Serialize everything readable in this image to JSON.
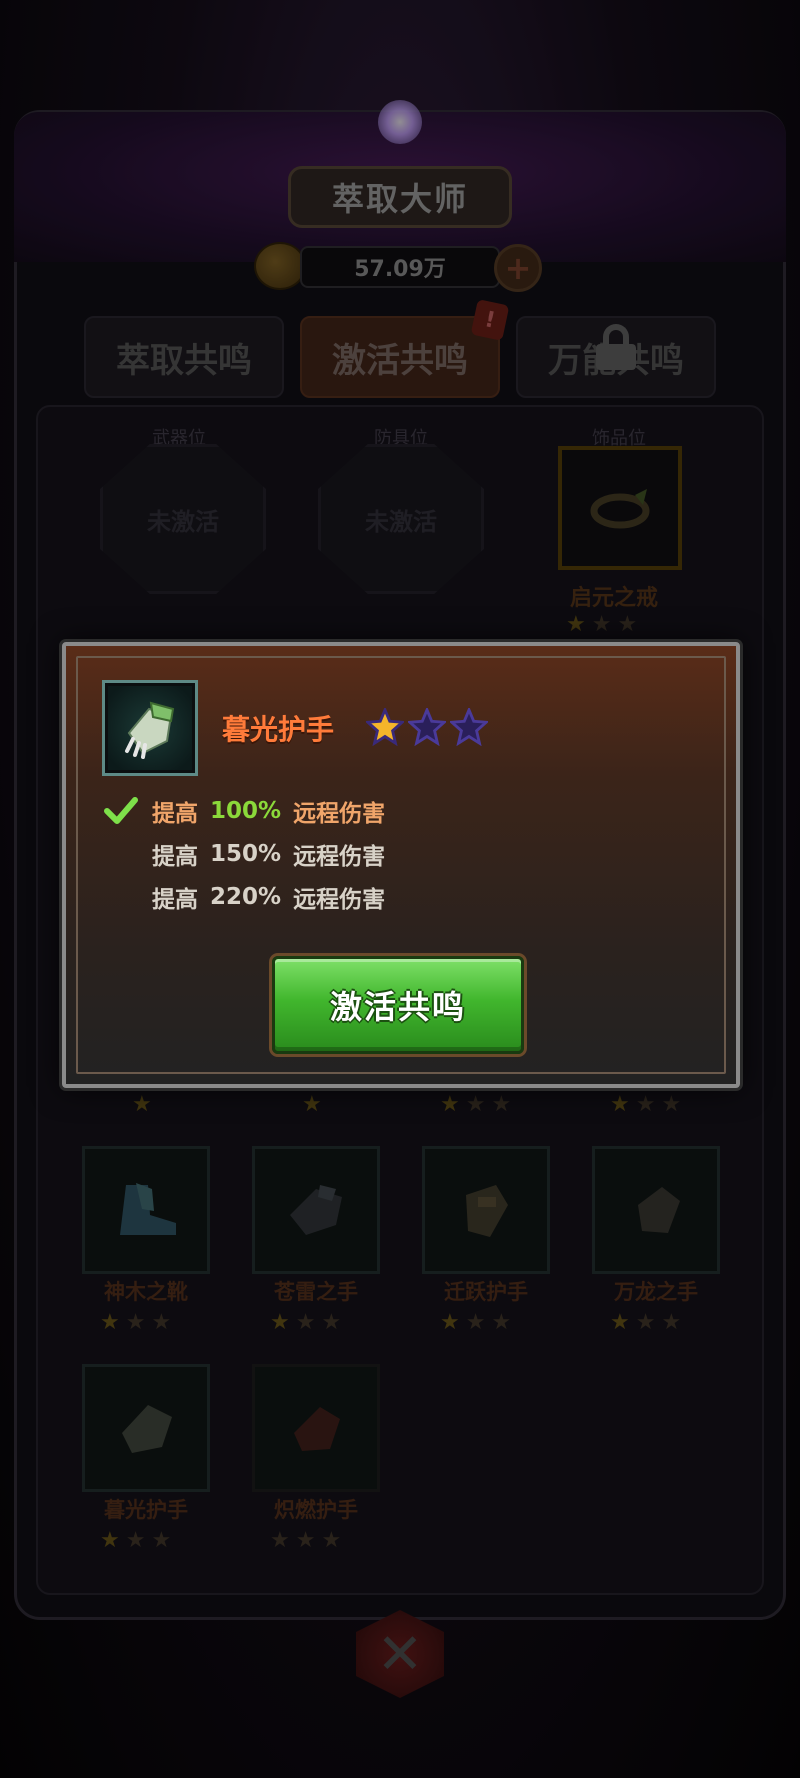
{
  "header": {
    "title": "萃取大师",
    "currency_amount": "57.09万",
    "plus_label": "+"
  },
  "tabs": [
    {
      "label": "萃取共鸣"
    },
    {
      "label": "激活共鸣"
    },
    {
      "label": "万能共鸣",
      "locked": true
    }
  ],
  "badge": "!",
  "slots": [
    {
      "label": "武器位",
      "state": "未激活"
    },
    {
      "label": "防具位",
      "state": "未激活"
    },
    {
      "label": "饰品位",
      "name": "启元之戒",
      "stars": 1
    }
  ],
  "items_row1_stars": [
    1,
    1,
    1,
    1
  ],
  "items": [
    {
      "name": "神木之靴",
      "stars": 1
    },
    {
      "name": "苍雷之手",
      "stars": 1
    },
    {
      "name": "迁跃护手",
      "stars": 1
    },
    {
      "name": "万龙之手",
      "stars": 1
    },
    {
      "name": "暮光护手",
      "stars": 1
    },
    {
      "name": "炽燃护手",
      "stars": 0
    }
  ],
  "popup": {
    "item_name": "暮光护手",
    "stars_filled": 1,
    "stars_total": 3,
    "effects": [
      {
        "label": "提高",
        "value": "100%",
        "what": "远程伤害",
        "active": true
      },
      {
        "label": "提高",
        "value": "150%",
        "what": "远程伤害",
        "active": false
      },
      {
        "label": "提高",
        "value": "220%",
        "what": "远程伤害",
        "active": false
      }
    ],
    "button_label": "激活共鸣"
  },
  "colors": {
    "title_orange": "#ff7b3a",
    "active_green": "#8bd93a",
    "button_green": "#41b62d",
    "star_gold": "#f5b52a",
    "star_empty": "#3a2a7a"
  },
  "icons": {
    "item_icon": "gauntlet-icon",
    "check": "checkmark-icon",
    "star": "star-icon",
    "lock": "lock-icon",
    "coin": "coin-icon"
  }
}
